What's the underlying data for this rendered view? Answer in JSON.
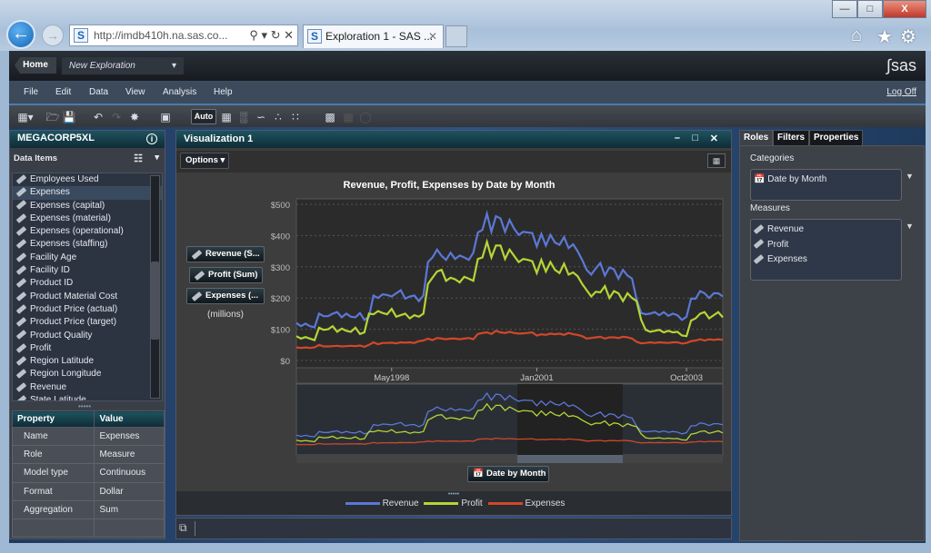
{
  "browser": {
    "url": "http://imdb410h.na.sas.co...",
    "tab_title": "Exploration 1 - SAS ...",
    "window_controls": [
      "minimize",
      "maximize",
      "close"
    ],
    "toolbar_icons": [
      "home-icon",
      "star-icon",
      "gear-icon"
    ]
  },
  "app": {
    "home_label": "Home",
    "exploration": "New Exploration",
    "brand": "sas",
    "logoff": "Log Off",
    "accent": "#4a7cb0"
  },
  "menu": [
    "File",
    "Edit",
    "Data",
    "View",
    "Analysis",
    "Help"
  ],
  "toolbar": {
    "auto_label": "Auto"
  },
  "left": {
    "datasource": "MEGACORP5XL",
    "data_items_label": "Data Items",
    "items": [
      "Employees Used",
      "Expenses",
      "Expenses (capital)",
      "Expenses (material)",
      "Expenses (operational)",
      "Expenses (staffing)",
      "Facility Age",
      "Facility ID",
      "Product ID",
      "Product Material Cost",
      "Product Price (actual)",
      "Product Price (target)",
      "Product Quality",
      "Profit",
      "Region Latitude",
      "Region Longitude",
      "Revenue",
      "State Latitude"
    ],
    "selected": "Expenses",
    "prop_headers": [
      "Property",
      "Value"
    ],
    "properties": [
      {
        "k": "Name",
        "v": "Expenses"
      },
      {
        "k": "Role",
        "v": "Measure"
      },
      {
        "k": "Model type",
        "v": "Continuous"
      },
      {
        "k": "Format",
        "v": "Dollar"
      },
      {
        "k": "Aggregation",
        "v": "Sum"
      }
    ]
  },
  "viz": {
    "title": "Visualization 1",
    "options_label": "Options",
    "measure_buttons": [
      "Revenue (S...",
      "Profit (Sum)",
      "Expenses (..."
    ],
    "units_note": "(millions)",
    "category_button": "Date by Month"
  },
  "right": {
    "tabs": [
      "Roles",
      "Filters",
      "Properties"
    ],
    "active_tab": "Roles",
    "categories_label": "Categories",
    "categories": [
      "Date by Month"
    ],
    "measures_label": "Measures",
    "measures": [
      "Revenue",
      "Profit",
      "Expenses"
    ]
  },
  "chart_data": {
    "type": "line",
    "title": "Revenue, Profit, Expenses by Date by Month",
    "xlabel": "",
    "ylabel": "",
    "ylim": [
      0,
      500
    ],
    "yticks": [
      "$0",
      "$100",
      "$200",
      "$300",
      "$400",
      "$500"
    ],
    "xticks": [
      "May1998",
      "Jan2001",
      "Oct2003"
    ],
    "grid": true,
    "legend": "bottom",
    "x": [
      "Aug1996",
      "Sep1996",
      "Oct1996",
      "Nov1996",
      "Dec1996",
      "Jan1997",
      "Feb1997",
      "Mar1997",
      "Apr1997",
      "May1997",
      "Jun1997",
      "Jul1997",
      "Aug1997",
      "Sep1997",
      "Oct1997",
      "Nov1997",
      "Dec1997",
      "Jan1998",
      "Feb1998",
      "Mar1998",
      "Apr1998",
      "May1998",
      "Jun1998",
      "Jul1998",
      "Aug1998",
      "Sep1998",
      "Oct1998",
      "Nov1998",
      "Dec1998",
      "Jan1999",
      "Feb1999",
      "Mar1999",
      "Apr1999",
      "May1999",
      "Jun1999",
      "Jul1999",
      "Aug1999",
      "Sep1999",
      "Oct1999",
      "Nov1999",
      "Dec1999",
      "Jan2000",
      "Feb2000",
      "Mar2000",
      "Apr2000",
      "May2000",
      "Jun2000",
      "Jul2000",
      "Aug2000",
      "Sep2000",
      "Oct2000",
      "Nov2000",
      "Dec2000",
      "Jan2001",
      "Feb2001",
      "Mar2001",
      "Apr2001",
      "May2001",
      "Jun2001",
      "Jul2001",
      "Aug2001",
      "Sep2001",
      "Oct2001",
      "Nov2001",
      "Dec2001",
      "Jan2002",
      "Feb2002",
      "Mar2002",
      "Apr2002",
      "May2002",
      "Jun2002",
      "Jul2002",
      "Aug2002",
      "Sep2002",
      "Oct2002",
      "Nov2002",
      "Dec2002",
      "Jan2003",
      "Feb2003",
      "Mar2003",
      "Apr2003",
      "May2003",
      "Jun2003",
      "Jul2003",
      "Aug2003",
      "Sep2003",
      "Oct2003",
      "Nov2003",
      "Dec2003",
      "Jan2004",
      "Feb2004",
      "Mar2004",
      "Apr2004",
      "May2004",
      "Jun2004"
    ],
    "series": [
      {
        "name": "Revenue",
        "color": "#5b78d6",
        "values": [
          120,
          110,
          118,
          110,
          106,
          150,
          142,
          142,
          150,
          155,
          138,
          150,
          140,
          138,
          152,
          130,
          140,
          208,
          200,
          212,
          210,
          205,
          215,
          225,
          198,
          205,
          208,
          190,
          208,
          315,
          330,
          355,
          335,
          322,
          345,
          325,
          336,
          330,
          322,
          345,
          410,
          418,
          470,
          412,
          462,
          455,
          412,
          450,
          422,
          402,
          412,
          410,
          408,
          365,
          405,
          368,
          402,
          378,
          370,
          395,
          360,
          372,
          350,
          322,
          290,
          275,
          295,
          312,
          272,
          298,
          292,
          262,
          290,
          272,
          262,
          195,
          152,
          148,
          150,
          155,
          145,
          155,
          143,
          150,
          145,
          130,
          140,
          198,
          198,
          222,
          215,
          200,
          215,
          215,
          205
        ]
      },
      {
        "name": "Profit",
        "color": "#b5d535",
        "values": [
          78,
          70,
          75,
          70,
          65,
          105,
          98,
          100,
          110,
          92,
          102,
          95,
          92,
          105,
          85,
          90,
          150,
          148,
          158,
          152,
          148,
          165,
          140,
          145,
          150,
          135,
          145,
          140,
          150,
          245,
          265,
          285,
          290,
          255,
          265,
          260,
          250,
          268,
          262,
          255,
          325,
          330,
          380,
          330,
          368,
          368,
          325,
          355,
          335,
          315,
          325,
          322,
          318,
          280,
          322,
          285,
          315,
          290,
          280,
          310,
          275,
          282,
          270,
          245,
          225,
          205,
          220,
          218,
          238,
          200,
          222,
          215,
          190,
          215,
          200,
          190,
          130,
          98,
          92,
          95,
          98,
          90,
          95,
          90,
          92,
          80,
          78,
          128,
          135,
          150,
          155,
          135,
          145,
          155,
          138
        ]
      },
      {
        "name": "Expenses",
        "color": "#d2472a",
        "values": [
          42,
          40,
          42,
          40,
          42,
          50,
          45,
          45,
          46,
          47,
          45,
          46,
          47,
          46,
          48,
          44,
          50,
          58,
          52,
          56,
          56,
          57,
          55,
          58,
          57,
          58,
          56,
          62,
          64,
          70,
          65,
          72,
          70,
          68,
          70,
          70,
          68,
          70,
          72,
          68,
          85,
          88,
          90,
          85,
          95,
          90,
          88,
          92,
          88,
          86,
          87,
          88,
          90,
          80,
          84,
          82,
          86,
          84,
          86,
          82,
          88,
          84,
          82,
          78,
          70,
          72,
          74,
          76,
          70,
          74,
          74,
          72,
          76,
          74,
          70,
          60,
          55,
          56,
          58,
          56,
          58,
          57,
          56,
          58,
          58,
          54,
          56,
          62,
          64,
          68,
          64,
          68,
          66,
          68,
          66
        ]
      }
    ]
  }
}
